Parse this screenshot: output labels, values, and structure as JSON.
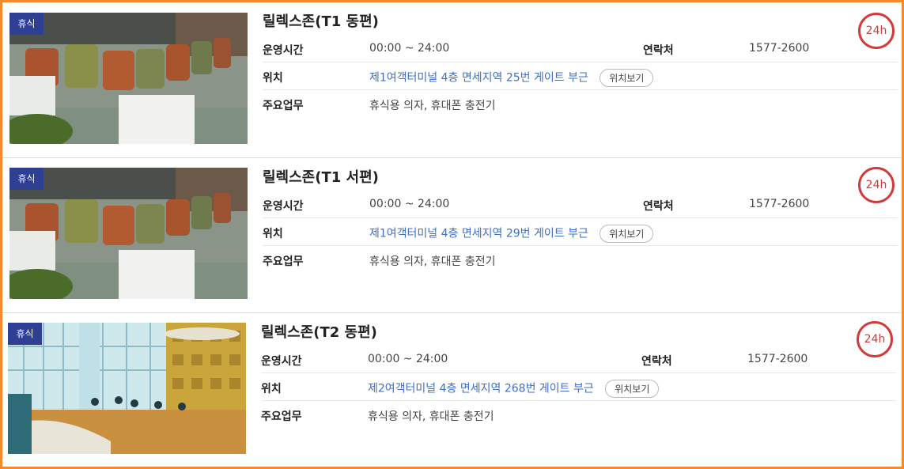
{
  "cards": [
    {
      "badge": "휴식",
      "title": "릴렉스존(T1 동편)",
      "hours_label": "운영시간",
      "hours": "00:00 ~ 24:00",
      "contact_label": "연락처",
      "contact": "1577-2600",
      "location_label": "위치",
      "location": "제1여객터미널 4층 면세지역 25번 게이트 부근",
      "map_button": "위치보기",
      "duties_label": "주요업무",
      "duties": "휴식용 의자, 휴대폰 충전기",
      "open_badge": "24h"
    },
    {
      "badge": "휴식",
      "title": "릴렉스존(T1 서편)",
      "hours_label": "운영시간",
      "hours": "00:00 ~ 24:00",
      "contact_label": "연락처",
      "contact": "1577-2600",
      "location_label": "위치",
      "location": "제1여객터미널 4층 면세지역 29번 게이트 부근",
      "map_button": "위치보기",
      "duties_label": "주요업무",
      "duties": "휴식용 의자, 휴대폰 충전기",
      "open_badge": "24h"
    },
    {
      "badge": "휴식",
      "title": "릴렉스존(T2 동편)",
      "hours_label": "운영시간",
      "hours": "00:00 ~ 24:00",
      "contact_label": "연락처",
      "contact": "1577-2600",
      "location_label": "위치",
      "location": "제2여객터미널 4층 면세지역 268번 게이트 부근",
      "map_button": "위치보기",
      "duties_label": "주요업무",
      "duties": "휴식용 의자, 휴대폰 충전기",
      "open_badge": "24h"
    }
  ],
  "colors": {
    "frame": "#f58a2a",
    "badge": "#2f3f93",
    "link": "#3d6fc6",
    "open_badge": "#d33b3b"
  }
}
